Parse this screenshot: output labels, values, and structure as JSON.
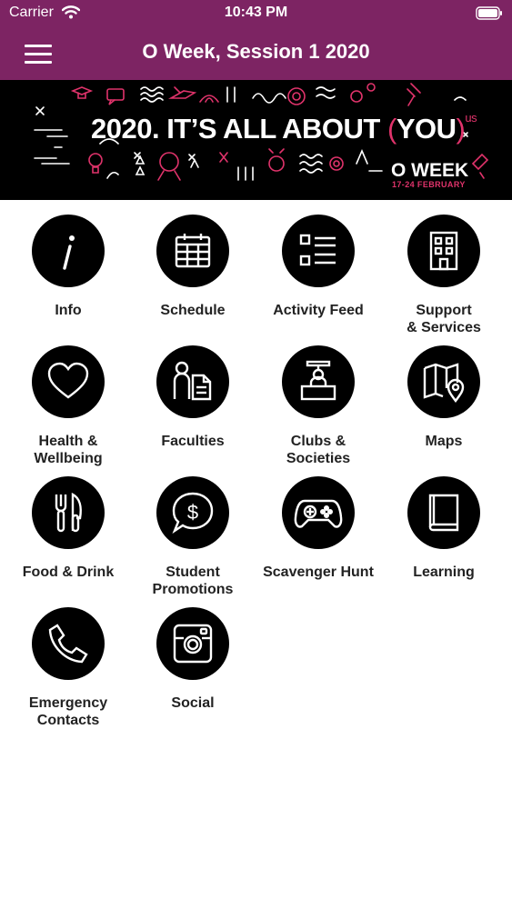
{
  "status_bar": {
    "carrier": "Carrier",
    "time": "10:43 PM"
  },
  "nav": {
    "title": "O Week, Session 1 2020"
  },
  "banner": {
    "headline_main": "2020. IT’S ALL ABOUT",
    "headline_open": "(",
    "headline_you": "YOU",
    "headline_close": ")",
    "headline_sup": "us",
    "event": "O WEEK",
    "dates": "17-24 FEBRUARY"
  },
  "tiles": [
    {
      "label": "Info",
      "icon": "info-icon"
    },
    {
      "label": "Schedule",
      "icon": "calendar-icon"
    },
    {
      "label": "Activity Feed",
      "icon": "list-icon"
    },
    {
      "label": "Support\n& Services",
      "icon": "building-icon"
    },
    {
      "label": "Health &\nWellbeing",
      "icon": "heart-icon"
    },
    {
      "label": "Faculties",
      "icon": "person-document-icon"
    },
    {
      "label": "Clubs &\nSocieties",
      "icon": "booth-icon"
    },
    {
      "label": "Maps",
      "icon": "map-icon"
    },
    {
      "label": "Food & Drink",
      "icon": "cutlery-icon"
    },
    {
      "label": "Student\nPromotions",
      "icon": "dollar-speech-icon"
    },
    {
      "label": "Scavenger Hunt",
      "icon": "gamepad-icon"
    },
    {
      "label": "Learning",
      "icon": "book-icon"
    },
    {
      "label": "Emergency\nContacts",
      "icon": "phone-icon"
    },
    {
      "label": "Social",
      "icon": "instagram-icon"
    }
  ],
  "colors": {
    "brand": "#7d2463",
    "accent": "#e0336b",
    "icon_bg": "#000000"
  }
}
